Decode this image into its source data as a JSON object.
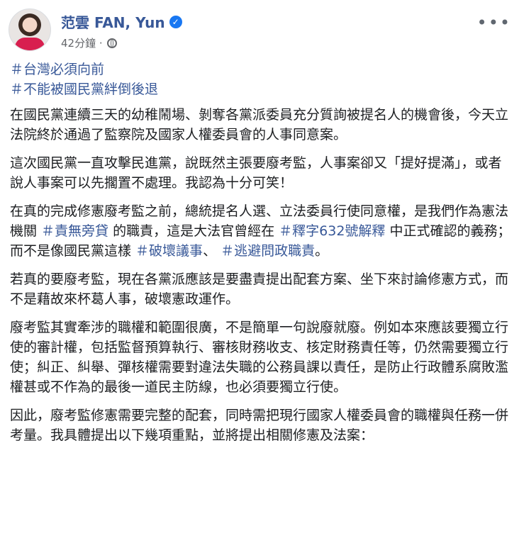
{
  "author": {
    "name": "范雲 FAN, Yun",
    "verified_icon": "verified-badge-icon"
  },
  "post_meta": {
    "time": "42分鐘 ·",
    "privacy_icon": "globe-icon"
  },
  "hashtags": [
    "＃台灣必須向前",
    "＃不能被國民黨絆倒後退"
  ],
  "paragraphs": {
    "p1": "在國民黨連續三天的幼稚鬧場、剝奪各黨派委員充分質詢被提名人的機會後，今天立法院終於通過了監察院及國家人權委員會的人事同意案。",
    "p2": "這次國民黨一直攻擊民進黨，說既然主張要廢考監，人事案卻又「提好提滿」，或者說人事案可以先擱置不處理。我認為十分可笑！",
    "p3": {
      "part1": "在真的完成修憲廢考監之前，總統提名人選、立法委員行使同意權，是我們作為憲法機關 ",
      "tag1": "＃責無旁貸",
      "part2": " 的職責，這是大法官曾經在 ",
      "tag2": "＃釋字632號解釋",
      "part3": " 中正式確認的義務；而不是像國民黨這樣 ",
      "tag3": "＃破壞議事",
      "part4": "、 ",
      "tag4": "＃逃避問政職責",
      "part5": "。"
    },
    "p4": "若真的要廢考監，現在各黨派應該是要盡責提出配套方案、坐下來討論修憲方式，而不是藉故來杯葛人事，破壞憲政運作。",
    "p5": "廢考監其實牽涉的職權和範圍很廣，不是簡單一句說廢就廢。例如本來應該要獨立行使的審計權，包括監督預算執行、審核財務收支、核定財務責任等，仍然需要獨立行使；糾正、糾舉、彈核權需要對違法失職的公務員課以責任，是防止行政體系腐敗濫權甚或不作為的最後一道民主防線，也必須要獨立行使。",
    "p6": "因此，廢考監修憲需要完整的配套，同時需把現行國家人權委員會的職權與任務一併考量。我具體提出以下幾項重點，並將提出相關修憲及法案："
  },
  "colors": {
    "link": "#385898",
    "text": "#1c1e21",
    "meta": "#65676b"
  }
}
